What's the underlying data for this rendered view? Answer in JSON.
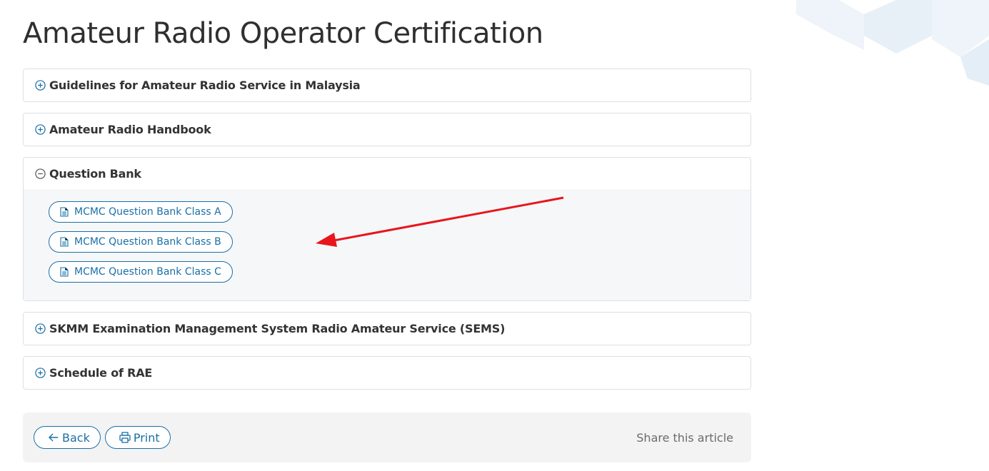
{
  "title": "Amateur Radio Operator Certification",
  "accordion": {
    "items": [
      {
        "label": "Guidelines for Amateur Radio Service in Malaysia",
        "expanded": false
      },
      {
        "label": "Amateur Radio Handbook",
        "expanded": false
      },
      {
        "label": "Question Bank",
        "expanded": true,
        "documents": [
          "MCMC Question Bank Class A",
          "MCMC Question Bank Class B",
          "MCMC Question Bank Class C"
        ]
      },
      {
        "label": "SKMM Examination Management System Radio Amateur Service (SEMS)",
        "expanded": false
      },
      {
        "label": "Schedule of RAE",
        "expanded": false
      }
    ],
    "icons": {
      "collapsed": "plus-circle-icon",
      "expanded": "minus-circle-icon",
      "document": "document-icon"
    }
  },
  "footer": {
    "back_label": "Back",
    "print_label": "Print",
    "share_label": "Share this article"
  },
  "colors": {
    "accent": "#1a6fa6",
    "annotation_arrow": "#e8161c",
    "panel_bg": "#f6f7f9",
    "footer_bg": "#f3f3f3"
  }
}
